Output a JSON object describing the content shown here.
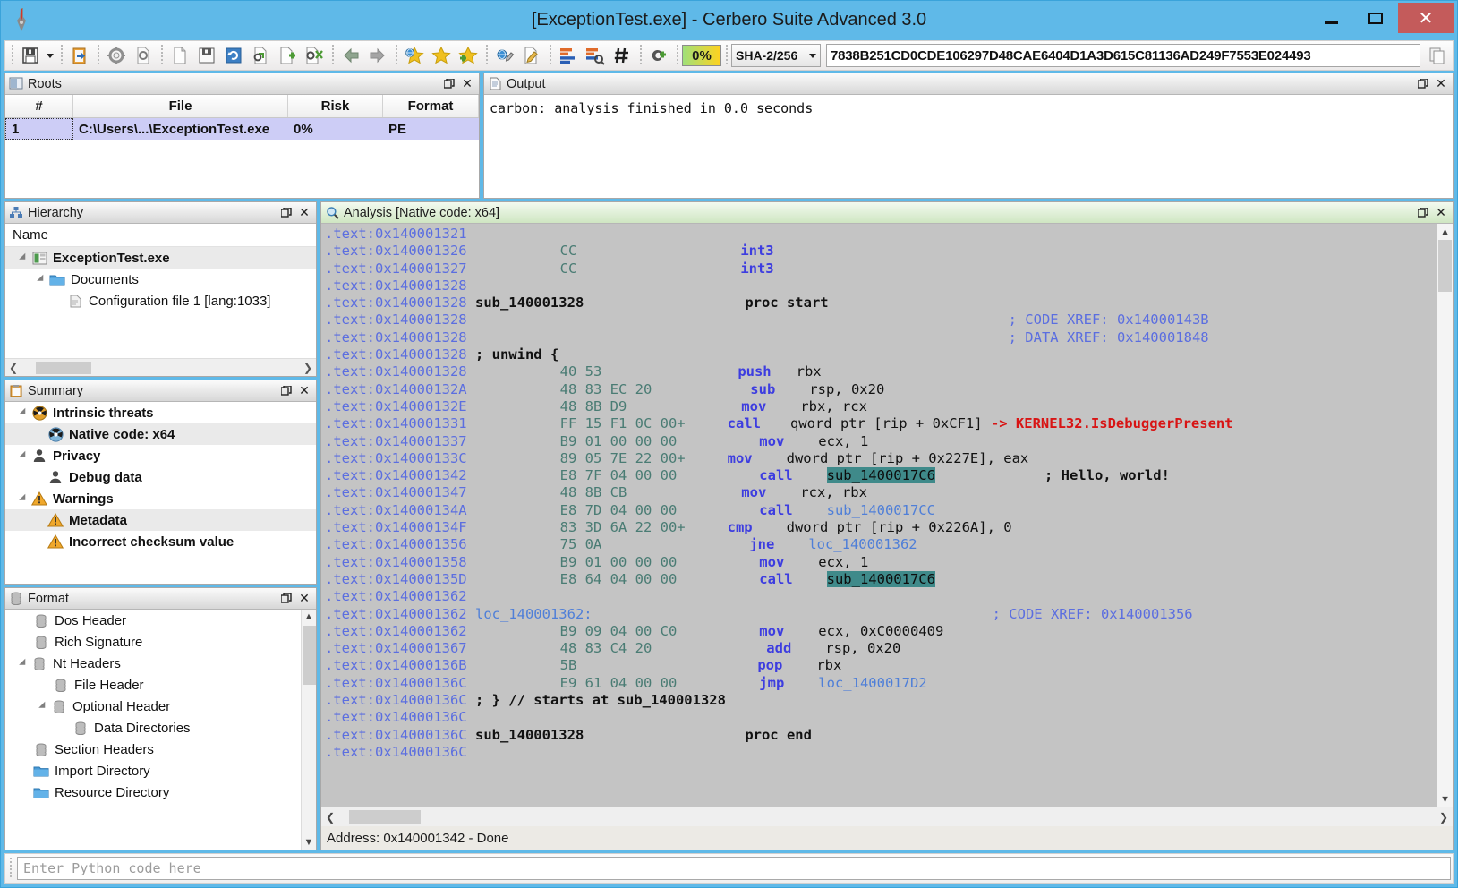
{
  "window": {
    "title": "[ExceptionTest.exe] - Cerbero Suite Advanced 3.0",
    "app_icon": "cerbero-logo-icon",
    "minimize_label": "Minimize",
    "maximize_label": "Maximize",
    "close_label": "Close"
  },
  "toolbar": {
    "risk_percent": "0%",
    "hash_algorithm": "SHA-2/256",
    "hash_value": "7838B251CD0CDE106297D48CAE6404D1A3D615C81136AD249F7553E024493",
    "buttons": [
      {
        "name": "save-button",
        "icon": "floppy-save-icon"
      },
      {
        "name": "save-dropdown-button",
        "icon": "chevron-down-icon"
      },
      {
        "name": "paste-button",
        "icon": "clipboard-paste-icon"
      },
      {
        "name": "settings-button",
        "icon": "gear-icon"
      },
      {
        "name": "scan-file-button",
        "icon": "document-scan-icon"
      },
      {
        "name": "new-document-button",
        "icon": "blank-document-icon"
      },
      {
        "name": "save-document-button",
        "icon": "document-save-icon"
      },
      {
        "name": "refresh-document-button",
        "icon": "document-refresh-icon"
      },
      {
        "name": "inspect-button",
        "icon": "magnifier-document-icon"
      },
      {
        "name": "add-document-button",
        "icon": "document-add-icon"
      },
      {
        "name": "close-document-button",
        "icon": "document-close-icon"
      },
      {
        "name": "back-button",
        "icon": "arrow-left-icon"
      },
      {
        "name": "forward-button",
        "icon": "arrow-right-icon"
      },
      {
        "name": "bookmark-globe-button",
        "icon": "star-globe-icon"
      },
      {
        "name": "bookmark-button",
        "icon": "star-icon"
      },
      {
        "name": "add-bookmark-button",
        "icon": "star-add-icon"
      },
      {
        "name": "annotate-button",
        "icon": "pen-globe-icon"
      },
      {
        "name": "edit-note-button",
        "icon": "pencil-document-icon"
      },
      {
        "name": "layout-view-button",
        "icon": "bar-layout-icon"
      },
      {
        "name": "layout-search-button",
        "icon": "bar-layout-search-icon"
      },
      {
        "name": "hash-button",
        "icon": "hash-icon"
      },
      {
        "name": "add-plugin-button",
        "icon": "plug-add-icon"
      },
      {
        "name": "copy-hash-button",
        "icon": "copy-icon"
      }
    ]
  },
  "roots": {
    "panel_title": "Roots",
    "panel_icon": "roots-panel-icon",
    "float_label": "Float",
    "close_label": "Close",
    "columns": [
      "#",
      "File",
      "Risk",
      "Format"
    ],
    "rows": [
      {
        "num": "1",
        "file": "C:\\Users\\...\\ExceptionTest.exe",
        "risk": "0%",
        "format": "PE"
      }
    ]
  },
  "output": {
    "panel_title": "Output",
    "panel_icon": "output-panel-icon",
    "text": "carbon: analysis finished in 0.0 seconds"
  },
  "hierarchy": {
    "panel_title": "Hierarchy",
    "panel_icon": "hierarchy-panel-icon",
    "column_header": "Name",
    "nodes": [
      {
        "label": "ExceptionTest.exe",
        "icon": "executable-icon",
        "depth": 0,
        "expanded": true,
        "bold": true,
        "selected": true
      },
      {
        "label": "Documents",
        "icon": "folder-icon",
        "depth": 1,
        "expanded": true,
        "bold": false,
        "selected": false
      },
      {
        "label": "Configuration file 1 [lang:1033]",
        "icon": "config-file-icon",
        "depth": 2,
        "expanded": false,
        "bold": false,
        "selected": false
      }
    ]
  },
  "summary": {
    "panel_title": "Summary",
    "panel_icon": "summary-panel-icon",
    "nodes": [
      {
        "label": "Intrinsic threats",
        "icon": "radiation-orange-icon",
        "depth": 0,
        "expanded": true,
        "selected": false
      },
      {
        "label": "Native code: x64",
        "icon": "radiation-blue-icon",
        "depth": 1,
        "expanded": false,
        "selected": true
      },
      {
        "label": "Privacy",
        "icon": "person-icon",
        "depth": 0,
        "expanded": true,
        "selected": false
      },
      {
        "label": "Debug data",
        "icon": "person-icon",
        "depth": 1,
        "expanded": false,
        "selected": false
      },
      {
        "label": "Warnings",
        "icon": "warning-triangle-icon",
        "depth": 0,
        "expanded": true,
        "selected": false
      },
      {
        "label": "Metadata",
        "icon": "warning-triangle-icon",
        "depth": 1,
        "expanded": false,
        "selected": true
      },
      {
        "label": "Incorrect checksum value",
        "icon": "warning-triangle-icon",
        "depth": 1,
        "expanded": false,
        "selected": false
      }
    ]
  },
  "format": {
    "panel_title": "Format",
    "panel_icon": "format-panel-icon",
    "nodes": [
      {
        "label": "Dos Header",
        "icon": "database-icon",
        "depth": 1,
        "expanded": false
      },
      {
        "label": "Rich Signature",
        "icon": "database-icon",
        "depth": 1,
        "expanded": false
      },
      {
        "label": "Nt Headers",
        "icon": "database-icon",
        "depth": 1,
        "expanded": true
      },
      {
        "label": "File Header",
        "icon": "database-icon",
        "depth": 2,
        "expanded": false
      },
      {
        "label": "Optional Header",
        "icon": "database-icon",
        "depth": 2,
        "expanded": true
      },
      {
        "label": "Data Directories",
        "icon": "database-icon",
        "depth": 3,
        "expanded": false
      },
      {
        "label": "Section Headers",
        "icon": "database-icon",
        "depth": 1,
        "expanded": false
      },
      {
        "label": "Import Directory",
        "icon": "folder-icon",
        "depth": 1,
        "expanded": false
      },
      {
        "label": "Resource Directory",
        "icon": "folder-icon",
        "depth": 1,
        "expanded": false
      }
    ]
  },
  "analysis": {
    "panel_title": "Analysis [Native code: x64]",
    "panel_icon": "magnifier-icon",
    "status": "Address: 0x140001342 - Done",
    "lines": [
      {
        "addr": ".text:0x140001321",
        "bytes": "",
        "mnem": "",
        "ops": "",
        "comment": "",
        "label": "",
        "xref": ""
      },
      {
        "addr": ".text:0x140001326",
        "bytes": "CC",
        "mnem": "int3",
        "ops": "",
        "comment": "",
        "label": "",
        "xref": ""
      },
      {
        "addr": ".text:0x140001327",
        "bytes": "CC",
        "mnem": "int3",
        "ops": "",
        "comment": "",
        "label": "",
        "xref": ""
      },
      {
        "addr": ".text:0x140001328",
        "bytes": "",
        "mnem": "",
        "ops": "",
        "comment": "",
        "label": "",
        "xref": ""
      },
      {
        "addr": ".text:0x140001328",
        "bytes": "",
        "mnem": "",
        "ops": "",
        "comment": "",
        "label": "sub_140001328",
        "proc": "proc start",
        "xref": ""
      },
      {
        "addr": ".text:0x140001328",
        "bytes": "",
        "mnem": "",
        "ops": "",
        "comment": "",
        "label": "",
        "xref": "; CODE XREF: 0x14000143B"
      },
      {
        "addr": ".text:0x140001328",
        "bytes": "",
        "mnem": "",
        "ops": "",
        "comment": "",
        "label": "",
        "xref": "; DATA XREF: 0x140001848"
      },
      {
        "addr": ".text:0x140001328",
        "bytes": "",
        "mnem": "",
        "ops": "",
        "comment": "",
        "label": "; unwind {",
        "xref": ""
      },
      {
        "addr": ".text:0x140001328",
        "bytes": "40 53",
        "mnem": "push",
        "ops": "rbx",
        "comment": "",
        "label": "",
        "xref": ""
      },
      {
        "addr": ".text:0x14000132A",
        "bytes": "48 83 EC 20",
        "mnem": "sub",
        "ops": "rsp, 0x20",
        "comment": "",
        "label": "",
        "xref": ""
      },
      {
        "addr": ".text:0x14000132E",
        "bytes": "48 8B D9",
        "mnem": "mov",
        "ops": "rbx, rcx",
        "comment": "",
        "label": "",
        "xref": ""
      },
      {
        "addr": ".text:0x140001331",
        "bytes": "FF 15 F1 0C 00+",
        "mnem": "call",
        "ops": "qword ptr [rip + 0xCF1]",
        "api": "-> KERNEL32.IsDebuggerPresent",
        "label": "",
        "xref": ""
      },
      {
        "addr": ".text:0x140001337",
        "bytes": "B9 01 00 00 00",
        "mnem": "mov",
        "ops": "ecx, 1",
        "comment": "",
        "label": "",
        "xref": ""
      },
      {
        "addr": ".text:0x14000133C",
        "bytes": "89 05 7E 22 00+",
        "mnem": "mov",
        "ops": "dword ptr [rip + 0x227E], eax",
        "comment": "",
        "label": "",
        "xref": ""
      },
      {
        "addr": ".text:0x140001342",
        "bytes": "E8 7F 04 00 00",
        "mnem": "call",
        "ops": "",
        "highlight": "sub_1400017C6",
        "comment": "; Hello, world!",
        "label": "",
        "xref": ""
      },
      {
        "addr": ".text:0x140001347",
        "bytes": "48 8B CB",
        "mnem": "mov",
        "ops": "rcx, rbx",
        "comment": "",
        "label": "",
        "xref": ""
      },
      {
        "addr": ".text:0x14000134A",
        "bytes": "E8 7D 04 00 00",
        "mnem": "call",
        "ops": "",
        "sym": "sub_1400017CC",
        "comment": "",
        "label": "",
        "xref": ""
      },
      {
        "addr": ".text:0x14000134F",
        "bytes": "83 3D 6A 22 00+",
        "mnem": "cmp",
        "ops": "dword ptr [rip + 0x226A], 0",
        "comment": "",
        "label": "",
        "xref": ""
      },
      {
        "addr": ".text:0x140001356",
        "bytes": "75 0A",
        "mnem": "jne",
        "ops": "",
        "sym": "loc_140001362",
        "comment": "",
        "label": "",
        "xref": ""
      },
      {
        "addr": ".text:0x140001358",
        "bytes": "B9 01 00 00 00",
        "mnem": "mov",
        "ops": "ecx, 1",
        "comment": "",
        "label": "",
        "xref": ""
      },
      {
        "addr": ".text:0x14000135D",
        "bytes": "E8 64 04 00 00",
        "mnem": "call",
        "ops": "",
        "highlight": "sub_1400017C6",
        "comment": "",
        "label": "",
        "xref": ""
      },
      {
        "addr": ".text:0x140001362",
        "bytes": "",
        "mnem": "",
        "ops": "",
        "comment": "",
        "label": "",
        "xref": ""
      },
      {
        "addr": ".text:0x140001362",
        "bytes": "",
        "mnem": "",
        "ops": "",
        "comment": "",
        "loclabel": "loc_140001362:",
        "xref": "; CODE XREF: 0x140001356"
      },
      {
        "addr": ".text:0x140001362",
        "bytes": "B9 09 04 00 C0",
        "mnem": "mov",
        "ops": "ecx, 0xC0000409",
        "comment": "",
        "label": "",
        "xref": ""
      },
      {
        "addr": ".text:0x140001367",
        "bytes": "48 83 C4 20",
        "mnem": "add",
        "ops": "rsp, 0x20",
        "comment": "",
        "label": "",
        "xref": ""
      },
      {
        "addr": ".text:0x14000136B",
        "bytes": "5B",
        "mnem": "pop",
        "ops": "rbx",
        "comment": "",
        "label": "",
        "xref": ""
      },
      {
        "addr": ".text:0x14000136C",
        "bytes": "E9 61 04 00 00",
        "mnem": "jmp",
        "ops": "",
        "sym": "loc_1400017D2",
        "comment": "",
        "label": "",
        "xref": ""
      },
      {
        "addr": ".text:0x14000136C",
        "bytes": "",
        "mnem": "",
        "ops": "",
        "comment": "",
        "label": "; } // starts at sub_140001328",
        "xref": ""
      },
      {
        "addr": ".text:0x14000136C",
        "bytes": "",
        "mnem": "",
        "ops": "",
        "comment": "",
        "label": "",
        "xref": ""
      },
      {
        "addr": ".text:0x14000136C",
        "bytes": "",
        "mnem": "",
        "ops": "",
        "comment": "",
        "label": "sub_140001328",
        "proc": "proc end",
        "xref": ""
      },
      {
        "addr": ".text:0x14000136C",
        "bytes": "",
        "mnem": "",
        "ops": "",
        "comment": "",
        "label": "",
        "xref": ""
      }
    ]
  },
  "python_bar": {
    "placeholder": "Enter Python code here",
    "value": ""
  }
}
